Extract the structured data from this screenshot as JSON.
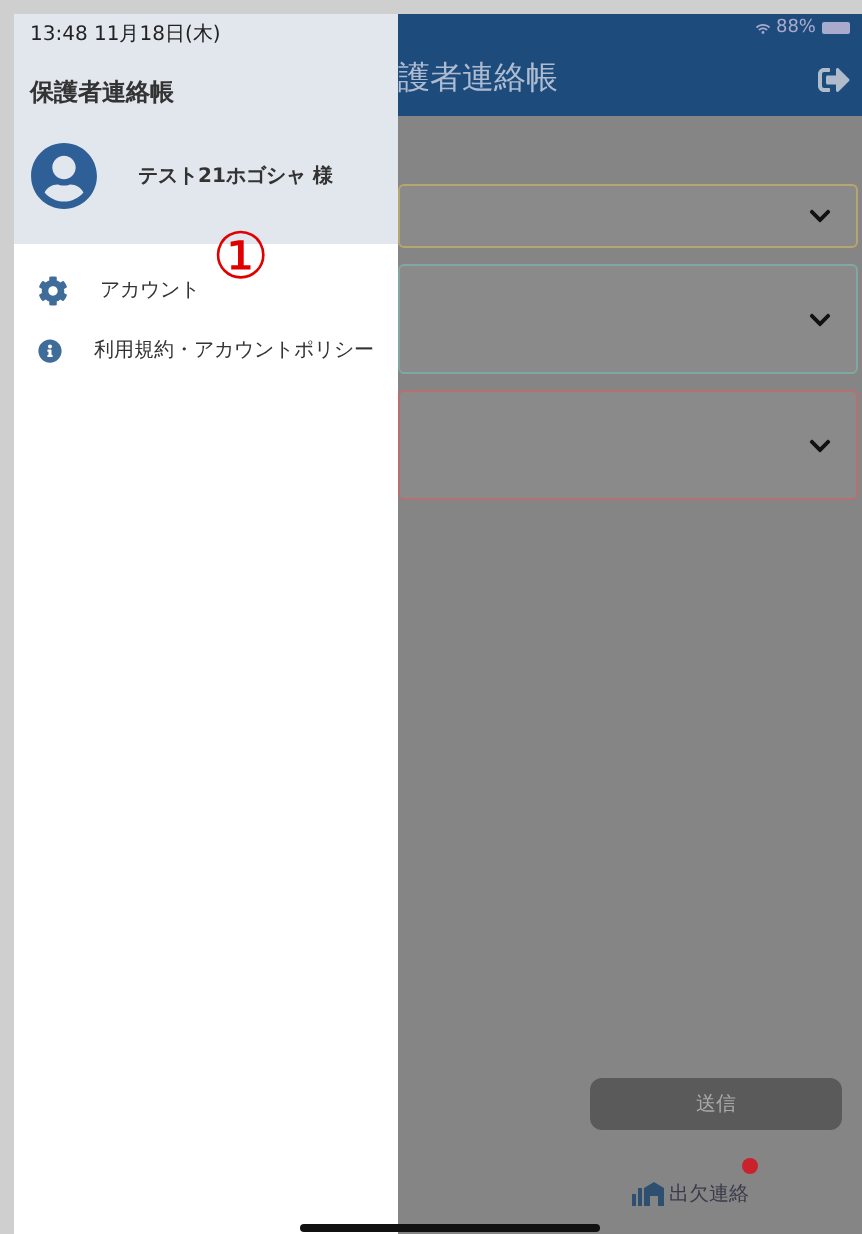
{
  "status_bar": {
    "time": "13:48",
    "date": "11月18日(木)",
    "battery": "88%"
  },
  "drawer": {
    "title": "保護者連絡帳",
    "user": "テスト21ホゴシャ 様",
    "items": [
      {
        "kind": "settings",
        "label": "アカウント"
      },
      {
        "kind": "info",
        "label": "利用規約・アカウントポリシー"
      }
    ]
  },
  "annotation": "①",
  "app": {
    "title": "護者連絡帳",
    "cards": [
      {
        "color": "#b5a66f"
      },
      {
        "color": "#7fa8a2"
      },
      {
        "color": "#b86f6f"
      }
    ],
    "send_button": "送信",
    "tab": {
      "label": "出欠連絡",
      "badge": true
    }
  }
}
